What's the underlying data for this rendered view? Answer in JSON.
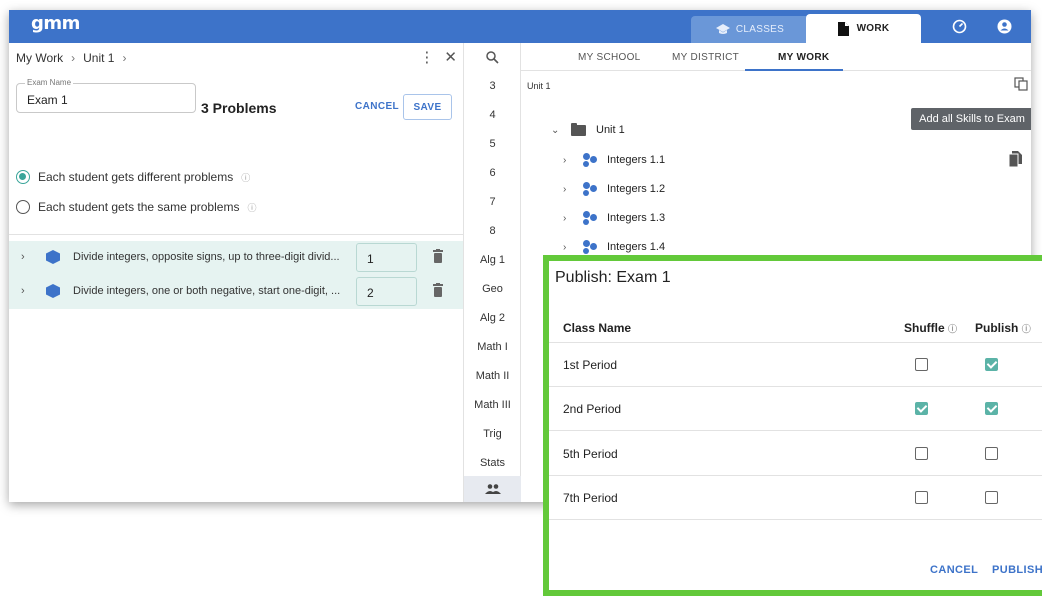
{
  "topbar": {
    "logo": "gmm",
    "tabs": [
      {
        "label": "CLASSES",
        "icon": "graduation-cap-icon",
        "active": false
      },
      {
        "label": "WORK",
        "icon": "document-icon",
        "active": true
      }
    ],
    "icons": [
      "speedometer-icon",
      "account-icon"
    ]
  },
  "left": {
    "breadcrumb": [
      "My Work",
      "Unit 1"
    ],
    "exam_name_label": "Exam Name",
    "exam_name_value": "Exam 1",
    "problems_count": "3 Problems",
    "cancel_label": "CANCEL",
    "save_label": "SAVE",
    "radio_options": [
      {
        "label": "Each student gets different problems",
        "selected": true
      },
      {
        "label": "Each student gets the same problems",
        "selected": false
      }
    ],
    "problems": [
      {
        "text": "Divide integers, opposite signs, up to three-digit divid...",
        "count": "1"
      },
      {
        "text": "Divide integers, one or both negative, start one-digit, ...",
        "count": "2"
      }
    ]
  },
  "mid": {
    "items": [
      "3",
      "4",
      "5",
      "6",
      "7",
      "8",
      "Alg 1",
      "Geo",
      "Alg 2",
      "Math I",
      "Math II",
      "Math III",
      "Trig",
      "Stats"
    ]
  },
  "right": {
    "tabs": [
      {
        "label": "MY SCHOOL",
        "active": false
      },
      {
        "label": "MY DISTRICT",
        "active": false
      },
      {
        "label": "MY WORK",
        "active": true
      }
    ],
    "crumb": "Unit 1",
    "tooltip": "Add all Skills to Exam",
    "folder": "Unit 1",
    "skills": [
      "Integers 1.1",
      "Integers 1.2",
      "Integers 1.3",
      "Integers 1.4"
    ]
  },
  "dialog": {
    "title": "Publish: Exam 1",
    "col_class": "Class Name",
    "col_shuffle": "Shuffle",
    "col_publish": "Publish",
    "rows": [
      {
        "name": "1st Period",
        "shuffle": false,
        "publish": true
      },
      {
        "name": "2nd Period",
        "shuffle": true,
        "publish": true
      },
      {
        "name": "5th Period",
        "shuffle": false,
        "publish": false
      },
      {
        "name": "7th Period",
        "shuffle": false,
        "publish": false
      }
    ],
    "cancel_label": "CANCEL",
    "publish_label": "PUBLISH"
  },
  "colors": {
    "primary": "#3d73c9",
    "teal": "#3aa59a",
    "highlight_border": "#63c93a"
  }
}
